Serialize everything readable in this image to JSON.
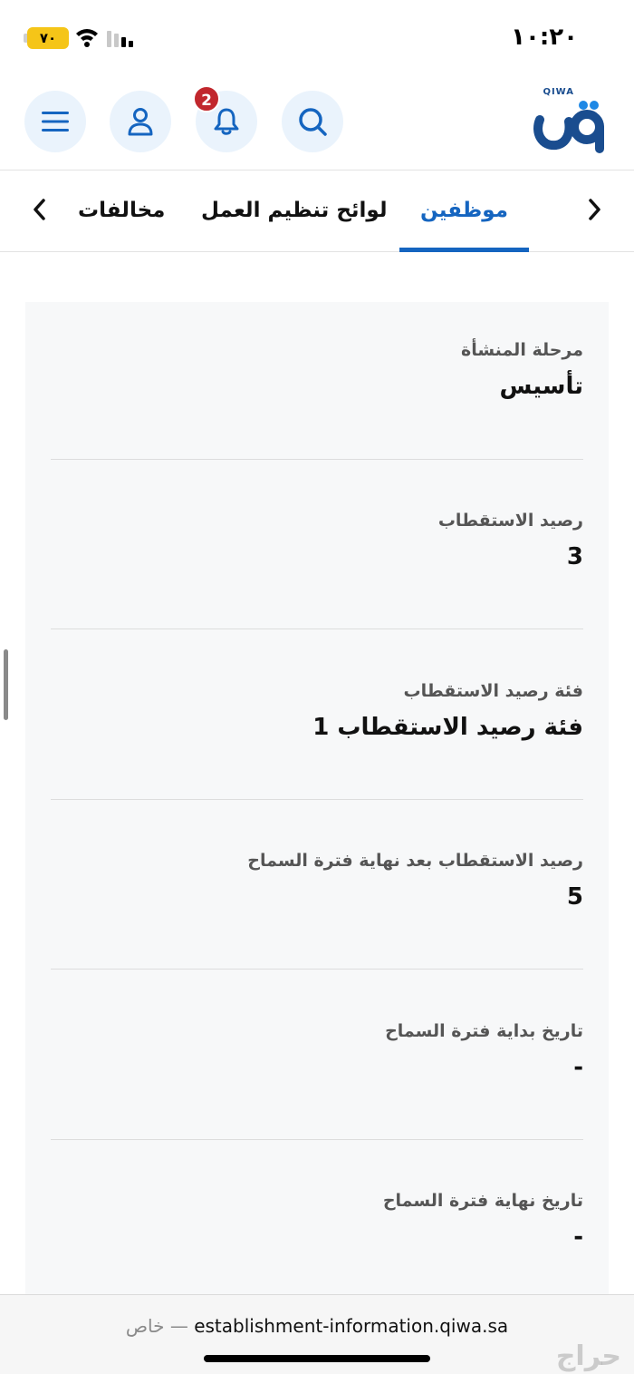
{
  "status_bar": {
    "time": "١٠:٢٠",
    "battery": "٧٠"
  },
  "header": {
    "logo_text": "QIWA",
    "notification_count": "2"
  },
  "tabs": [
    {
      "label": "موظفين",
      "active": true
    },
    {
      "label": "لوائح تنظيم العمل",
      "active": false
    },
    {
      "label": "مخالفات",
      "active": false
    }
  ],
  "fields": [
    {
      "label": "مرحلة المنشأة",
      "value": "تأسيس"
    },
    {
      "label": "رصيد الاستقطاب",
      "value": "3"
    },
    {
      "label": "فئة رصيد الاستقطاب",
      "value": "فئة رصيد الاستقطاب 1"
    },
    {
      "label": "رصيد الاستقطاب بعد نهاية فترة السماح",
      "value": "5"
    },
    {
      "label": "تاريخ بداية فترة السماح",
      "value": "-"
    },
    {
      "label": "تاريخ نهاية فترة السماح",
      "value": "-"
    }
  ],
  "browser": {
    "url": "establishment-information.qiwa.sa",
    "private_label": "خاص —"
  },
  "watermark": "حراج",
  "colors": {
    "accent": "#1565c0",
    "icon_bg": "#eaf3fc",
    "badge": "#c1272d",
    "card_bg": "#f7f8f9"
  }
}
